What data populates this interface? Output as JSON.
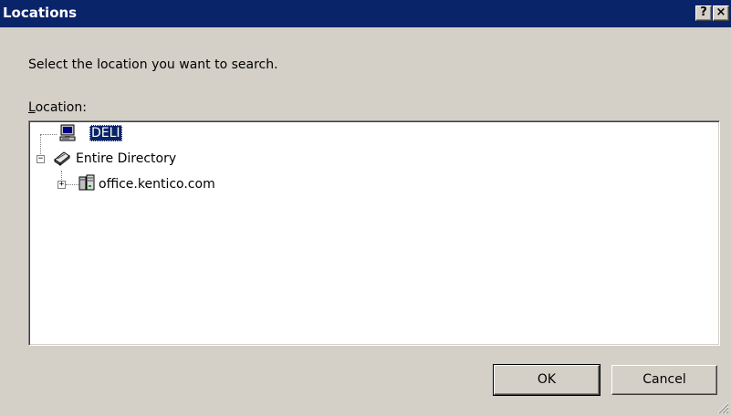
{
  "window": {
    "title": "Locations",
    "help_button": "?",
    "close_button": "×"
  },
  "prompt": "Select the location you want to search.",
  "location_label": {
    "accel": "L",
    "rest": "ocation:"
  },
  "tree": {
    "nodes": [
      {
        "label": "DELI",
        "icon": "computer-icon",
        "selected": true
      },
      {
        "label": "Entire Directory",
        "icon": "directory-book-icon",
        "expander": "−"
      },
      {
        "label": "office.kentico.com",
        "icon": "domain-servers-icon",
        "expander": "+"
      }
    ]
  },
  "buttons": {
    "ok": "OK",
    "cancel": "Cancel"
  },
  "colors": {
    "titlebar": "#0a246a",
    "face": "#d4d0c8",
    "selection": "#0a246a"
  }
}
